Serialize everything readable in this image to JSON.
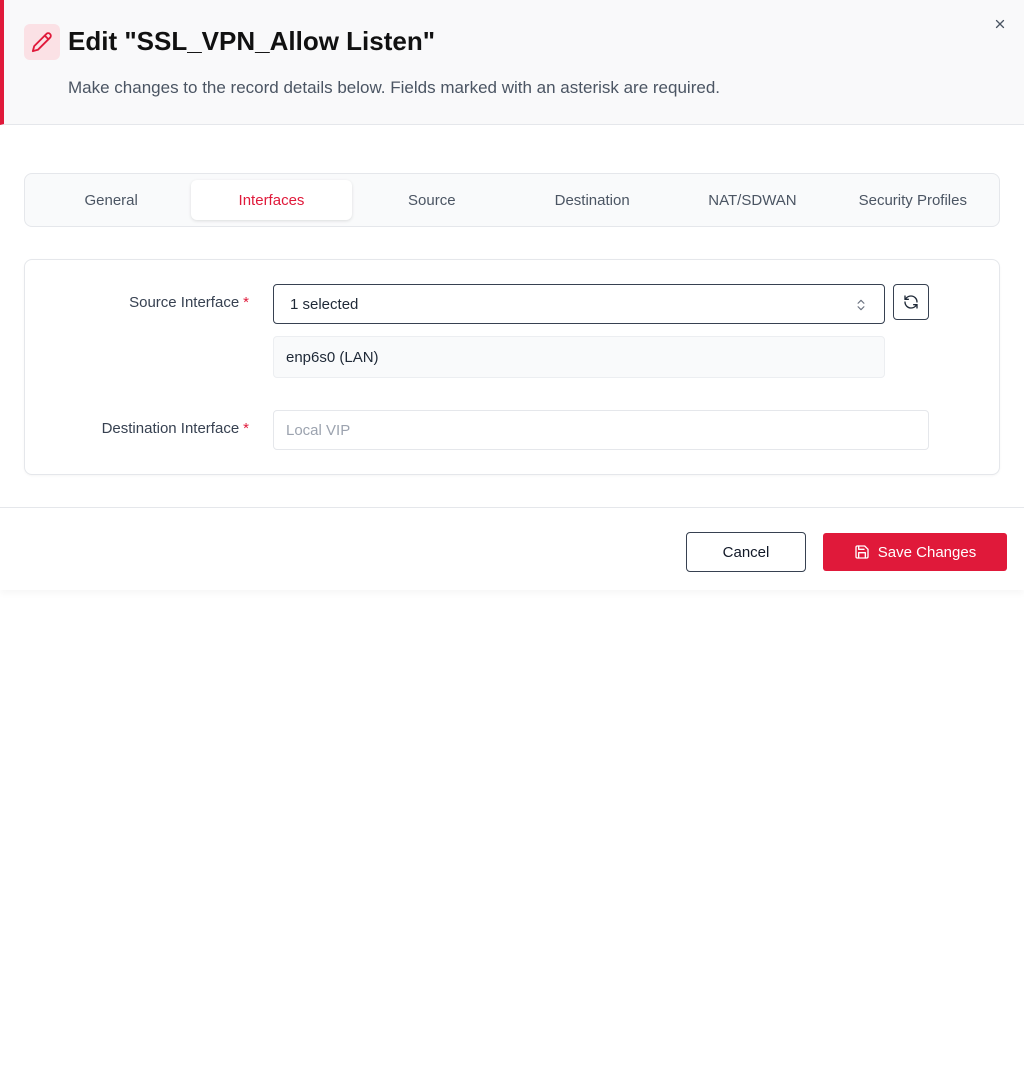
{
  "dialog": {
    "title": "Edit \"SSL_VPN_Allow Listen\"",
    "subtitle": "Make changes to the record details below. Fields marked with an asterisk are required.",
    "accent_color": "#e0193a",
    "header_icon": "pencil-icon",
    "close_icon": "close-icon"
  },
  "tabs": [
    {
      "label": "General",
      "active": false
    },
    {
      "label": "Interfaces",
      "active": true
    },
    {
      "label": "Source",
      "active": false
    },
    {
      "label": "Destination",
      "active": false
    },
    {
      "label": "NAT/SDWAN",
      "active": false
    },
    {
      "label": "Security Profiles",
      "active": false
    }
  ],
  "form": {
    "source_interface": {
      "label": "Source Interface",
      "required_mark": "*",
      "value": "1 selected",
      "selected_items": [
        "enp6s0 (LAN)"
      ],
      "chevron_icon": "chevron-up-down-icon",
      "refresh_icon": "refresh-icon"
    },
    "destination_interface": {
      "label": "Destination Interface",
      "required_mark": "*",
      "value": "",
      "placeholder": "Local VIP"
    }
  },
  "footer": {
    "cancel_label": "Cancel",
    "save_label": "Save Changes",
    "save_icon": "save-icon"
  }
}
